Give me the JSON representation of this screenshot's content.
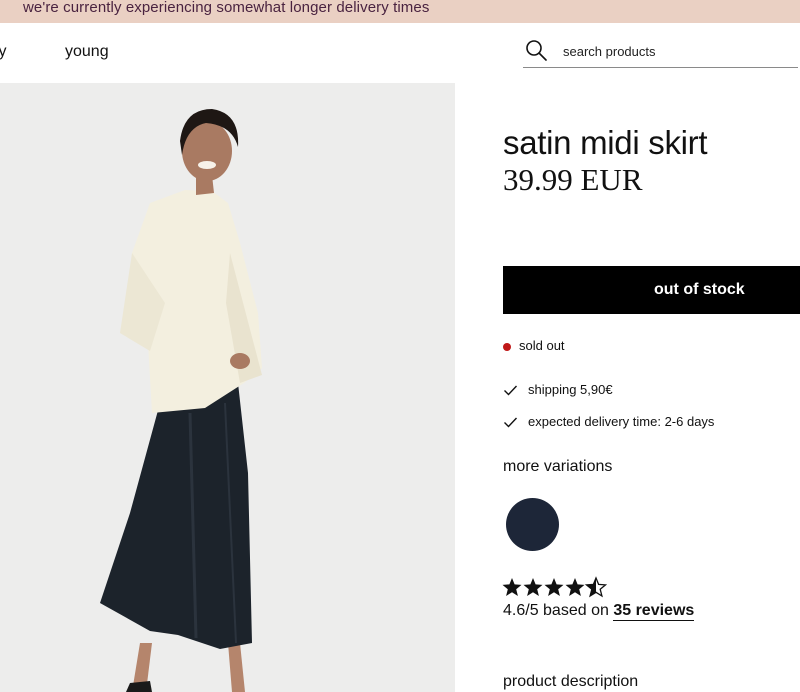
{
  "banner": {
    "text": "we're currently experiencing somewhat longer delivery times"
  },
  "nav": {
    "items": [
      {
        "label": "ty"
      },
      {
        "label": "young"
      }
    ]
  },
  "search": {
    "placeholder": "search products"
  },
  "product": {
    "title": "satin midi skirt",
    "price": "39.99 EUR",
    "button_label": "out of stock",
    "status": "sold out",
    "status_color": "#c01818",
    "info": [
      {
        "icon": "check-icon",
        "text": "shipping 5,90€"
      },
      {
        "icon": "check-icon",
        "text": "expected delivery time: 2-6 days"
      }
    ],
    "variations_title": "more variations",
    "variation_colors": [
      "#1d2638"
    ],
    "rating": {
      "stars": 4.6,
      "max": 5,
      "prefix": "4.6/5 based on",
      "reviews_link": "35 reviews"
    },
    "description_title": "product description"
  },
  "colors": {
    "banner_bg": "#ead0c3",
    "banner_text": "#4a2340",
    "button_bg": "#000000"
  }
}
